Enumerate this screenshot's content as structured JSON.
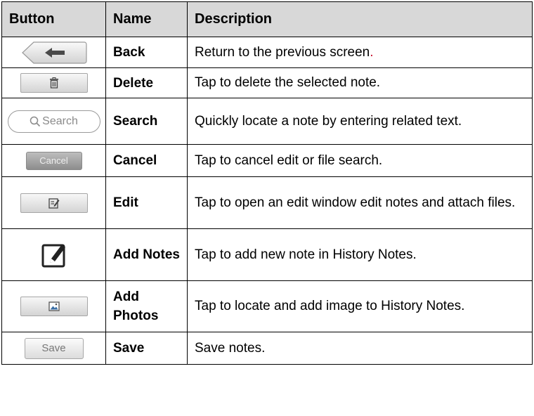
{
  "table": {
    "headers": {
      "button": "Button",
      "name": "Name",
      "description": "Description"
    },
    "rows": [
      {
        "icon": "back-arrow-icon",
        "name": "Back",
        "description": "Return to the previous screen",
        "description_end": "."
      },
      {
        "icon": "trash-icon",
        "name": "Delete",
        "description": "Tap to delete the selected note."
      },
      {
        "icon": "search-icon",
        "icon_label": "Search",
        "name": "Search",
        "description": "Quickly locate a note by entering related text."
      },
      {
        "icon": "cancel-button",
        "icon_label": "Cancel",
        "name": "Cancel",
        "description": "Tap to cancel edit or file search."
      },
      {
        "icon": "edit-icon",
        "name": "Edit",
        "description": "Tap to open an edit window edit notes and attach files."
      },
      {
        "icon": "add-note-icon",
        "name": "Add Notes",
        "description": "Tap to add new note in History Notes."
      },
      {
        "icon": "photo-icon",
        "name": "Add Photos",
        "description": "Tap to locate and add image to History Notes."
      },
      {
        "icon": "save-button",
        "icon_label": "Save",
        "name": "Save",
        "description": "Save notes."
      }
    ]
  },
  "colors": {
    "header_bg": "#d8d8d8",
    "border": "#000000",
    "accent_red": "#c8102e"
  }
}
